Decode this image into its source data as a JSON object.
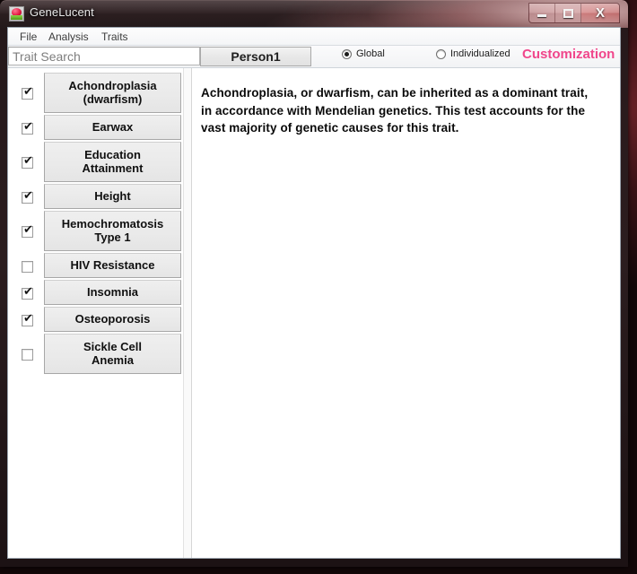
{
  "window": {
    "title": "GeneLucent",
    "icon": "tulip-icon",
    "controls": {
      "minimize": "minimize-icon",
      "maximize": "maximize-icon",
      "close": "X"
    }
  },
  "menubar": {
    "items": [
      {
        "label": "File"
      },
      {
        "label": "Analysis"
      },
      {
        "label": "Traits"
      }
    ]
  },
  "toolbar": {
    "search": {
      "value": "",
      "placeholder": "Trait Search"
    },
    "person_button": "Person1",
    "scope_options": [
      {
        "label": "Global",
        "selected": true
      },
      {
        "label": "Individualized",
        "selected": false
      }
    ],
    "customization_label": "Customization",
    "customization_color": "#f0468b"
  },
  "traits": [
    {
      "label": "Achondroplasia (dwarfism)",
      "checked": true
    },
    {
      "label": "Earwax",
      "checked": true
    },
    {
      "label": "Education Attainment",
      "checked": true
    },
    {
      "label": "Height",
      "checked": true
    },
    {
      "label": "Hemochromatosis Type 1",
      "checked": true
    },
    {
      "label": "HIV Resistance",
      "checked": false
    },
    {
      "label": "Insomnia",
      "checked": true
    },
    {
      "label": "Osteoporosis",
      "checked": true
    },
    {
      "label": "Sickle Cell Anemia",
      "checked": false
    }
  ],
  "detail": {
    "description": "Achondroplasia, or dwarfism, can be inherited as a dominant trait, in accordance with Mendelian genetics. This test accounts for the vast majority of genetic causes for this trait."
  }
}
